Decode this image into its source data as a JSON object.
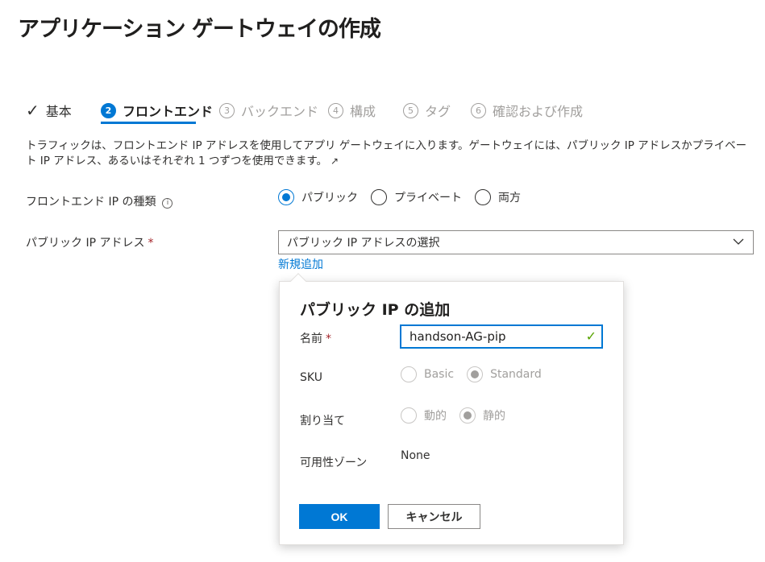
{
  "header": {
    "title": "アプリケーション ゲートウェイの作成",
    "more_label": "…"
  },
  "tabs": [
    {
      "num": "",
      "label": "基本",
      "state": "done"
    },
    {
      "num": "2",
      "label": "フロントエンド",
      "state": "active"
    },
    {
      "num": "3",
      "label": "バックエンド",
      "state": "pending"
    },
    {
      "num": "4",
      "label": "構成",
      "state": "pending"
    },
    {
      "num": "5",
      "label": "タグ",
      "state": "pending"
    },
    {
      "num": "6",
      "label": "確認および作成",
      "state": "pending"
    }
  ],
  "description": "トラフィックは、フロントエンド IP アドレスを使用してアプリ ゲートウェイに入ります。ゲートウェイには、パブリック IP アドレスかプライベート IP アドレス、あるいはそれぞれ 1 つずつを使用できます。",
  "form": {
    "ip_type_label": "フロントエンド IP の種類",
    "ip_type_options": [
      "パブリック",
      "プライベート",
      "両方"
    ],
    "ip_type_selected": "パブリック",
    "public_ip_label": "パブリック IP アドレス",
    "required_mark": "*",
    "public_ip_placeholder": "パブリック IP アドレスの選択",
    "add_new_link": "新規追加"
  },
  "callout": {
    "title": "パブリック IP の追加",
    "name_label": "名前",
    "name_value": "handson-AG-pip",
    "sku_label": "SKU",
    "sku_options": [
      "Basic",
      "Standard"
    ],
    "sku_selected": "Standard",
    "assignment_label": "割り当て",
    "assignment_options": [
      "動的",
      "静的"
    ],
    "assignment_selected": "静的",
    "zone_label": "可用性ゾーン",
    "zone_value": "None",
    "ok_label": "OK",
    "cancel_label": "キャンセル"
  },
  "colors": {
    "accent": "#0078d4",
    "required": "#a4262c",
    "valid": "#57a300"
  }
}
